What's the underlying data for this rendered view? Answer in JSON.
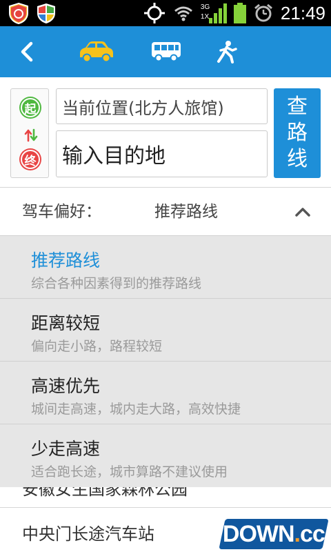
{
  "status_bar": {
    "time": "21:49",
    "network_label_top": "3G",
    "network_label_bottom": "1X"
  },
  "top_bar": {
    "back_icon": "back-arrow-icon",
    "modes": [
      {
        "name": "car-icon",
        "selected": true
      },
      {
        "name": "bus-icon",
        "selected": false
      },
      {
        "name": "walk-icon",
        "selected": false
      }
    ],
    "selected_color": "#f6c21c",
    "background": "#1e8fd8"
  },
  "route_form": {
    "start_marker": "起",
    "end_marker": "终",
    "from_value": "当前位置(北方人旅馆)",
    "to_placeholder": "输入目的地",
    "search_button_chars": [
      "查",
      "路",
      "线"
    ]
  },
  "preference": {
    "label": "驾车偏好：",
    "value": "推荐路线"
  },
  "options": [
    {
      "title": "推荐路线",
      "desc": "综合各种因素得到的推荐路线",
      "selected": true
    },
    {
      "title": "距离较短",
      "desc": "偏向走小路，路程较短",
      "selected": false
    },
    {
      "title": "高速优先",
      "desc": "城间走高速，城内走大路，高效快捷",
      "selected": false
    },
    {
      "title": "少走高速",
      "desc": "适合跑长途，城市算路不建议使用",
      "selected": false
    }
  ],
  "history": {
    "partial_item": "安徽女生国家森林公园",
    "item": "中央门长途汽车站"
  },
  "watermark": {
    "main": "DOWN",
    "dot": ".",
    "suffix": "cc"
  }
}
